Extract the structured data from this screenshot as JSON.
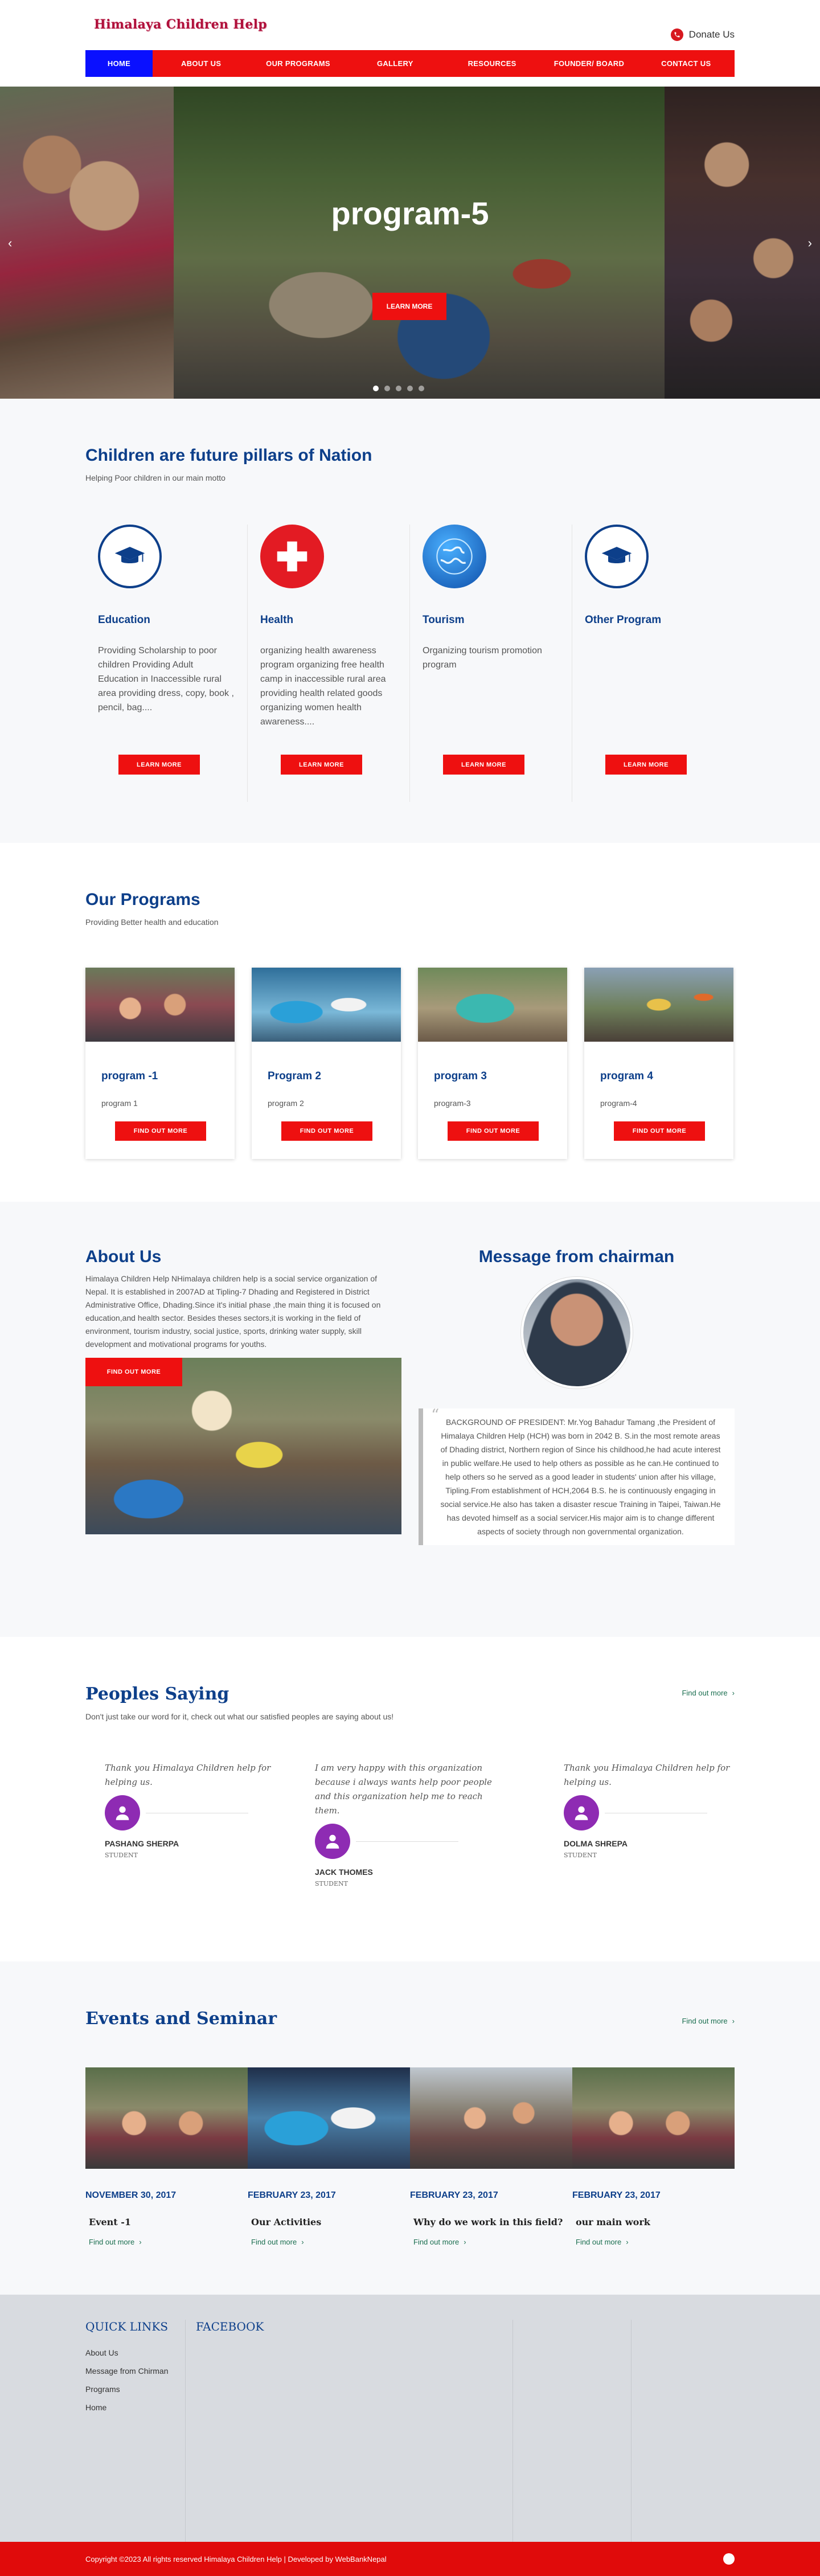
{
  "header": {
    "brand": "Himalaya Children Help",
    "donate": "Donate Us"
  },
  "nav": [
    "HOME",
    "ABOUT US",
    "OUR PROGRAMS",
    "GALLERY",
    "RESOURCES",
    "FOUNDER/ BOARD",
    "CONTACT US"
  ],
  "hero": {
    "title": "program-5",
    "button": "LEARN MORE",
    "prev": "‹",
    "next": "›"
  },
  "pillars": {
    "title": "Children are future pillars of Nation",
    "subtitle": "Helping Poor children in our main motto",
    "items": [
      {
        "icon": "graduation-cap-icon",
        "title": "Education",
        "text": "Providing Scholarship to poor children Providing Adult Education in Inaccessible rural area   providing dress, copy, book , pencil, bag....",
        "button": "LEARN MORE"
      },
      {
        "icon": "medical-cross-icon",
        "title": "Health",
        "text": "organizing health awareness program organizing free health camp in inaccessible rural area providing health related goods organizing women health awareness....",
        "button": "LEARN MORE"
      },
      {
        "icon": "globe-icon",
        "title": "Tourism",
        "text": "Organizing tourism promotion program",
        "button": "LEARN MORE"
      },
      {
        "icon": "graduation-cap-icon",
        "title": "Other Program",
        "text": "",
        "button": "LEARN MORE"
      }
    ]
  },
  "programs": {
    "title": "Our Programs",
    "subtitle": "Providing Better health and education",
    "items": [
      {
        "title": "program -1",
        "text": "program 1",
        "button": "FIND OUT MORE"
      },
      {
        "title": "Program 2",
        "text": "program 2",
        "button": "FIND OUT MORE"
      },
      {
        "title": "program 3",
        "text": "program-3",
        "button": "FIND OUT MORE"
      },
      {
        "title": "program 4",
        "text": "program-4",
        "button": "FIND OUT MORE"
      }
    ]
  },
  "about": {
    "title": "About Us",
    "text": "Himalaya Children Help NHimalaya children help is a social service organization of Nepal. It is established in 2007AD at Tipling-7 Dhading and Registered in District Administrative Office, Dhading.Since it's initial phase ,the main thing it is focused on education,and health sector. Besides theses sectors,it is working in the field of environment, tourism industry, social justice, sports, drinking water supply, skill development and motivational programs for youths.",
    "button": "FIND OUT MORE"
  },
  "chairman": {
    "title": "Message from chairman",
    "quote": "BACKGROUND OF PRESIDENT: Mr.Yog Bahadur Tamang ,the President of Himalaya Children Help (HCH) was born in 2042 B. S.in the most remote areas of Dhading district, Northern region of Since his childhood,he had acute interest in public welfare.He used to help others as possible as he can.He continued to help others so he served as a good leader in students' union after his village, Tipling.From establishment of HCH,2064 B.S. he is continuously engaging in social service.He also has taken a disaster rescue Training in Taipei, Taiwan.He has devoted himself as a social servicer.His major aim is to change different aspects of society through non governmental organization."
  },
  "testimonials": {
    "title": "Peoples Saying",
    "subtitle": "Don't just take our word for it, check out what our satisfied peoples are saying about us!",
    "find_more": "Find out more",
    "items": [
      {
        "quote": "Thank you Himalaya Children help for helping us.",
        "name": "PASHANG SHERPA",
        "role": "STUDENT"
      },
      {
        "quote": "I am very happy with this organization because i always wants help poor people and this organization help me to reach them.",
        "name": "JACK THOMES",
        "role": "STUDENT"
      },
      {
        "quote": "Thank you Himalaya Children help for helping us.",
        "name": "DOLMA SHREPA",
        "role": "STUDENT"
      }
    ]
  },
  "events": {
    "title": "Events and Seminar",
    "find_more": "Find out more",
    "items": [
      {
        "date": "NOVEMBER 30, 2017",
        "title": "Event -1",
        "more": "Find out more"
      },
      {
        "date": "FEBRUARY 23, 2017",
        "title": "Our Activities",
        "more": "Find out more"
      },
      {
        "date": "FEBRUARY 23, 2017",
        "title": "Why do we work in this field?",
        "more": "Find out more"
      },
      {
        "date": "FEBRUARY 23, 2017",
        "title": "our main work",
        "more": "Find out more"
      }
    ]
  },
  "footer": {
    "quick_links_title": "QUICK LINKS",
    "links": [
      "About Us",
      "Message from Chirman",
      "Programs",
      "Home"
    ],
    "facebook_title": "FACEBOOK",
    "copyright": "Copyright ©2023 All rights reserved Himalaya Children Help | Developed by WebBankNepal"
  },
  "colors": {
    "nav_red": "#ee1010",
    "nav_active_blue": "#0a10ff",
    "heading_blue": "#0d3f8a",
    "avatar_purple": "#8e2bb3",
    "footer_bg": "#d8dbe0"
  }
}
